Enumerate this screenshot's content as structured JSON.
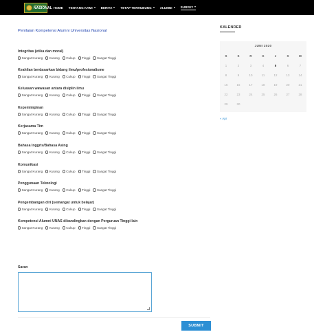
{
  "header": {
    "logo": {
      "small": "UNIVERSITAS",
      "big": "NASIONAL"
    },
    "nav": [
      {
        "label": "HOME",
        "dropdown": false,
        "active": false
      },
      {
        "label": "TENTANG KAMI",
        "dropdown": true,
        "active": false
      },
      {
        "label": "BERITA",
        "dropdown": true,
        "active": false
      },
      {
        "label": "TETAP TERHUBUNG",
        "dropdown": true,
        "active": false
      },
      {
        "label": "ALUMNI",
        "dropdown": true,
        "active": false
      },
      {
        "label": "SURVEY",
        "dropdown": true,
        "active": true
      }
    ]
  },
  "form": {
    "title": "Penilaian Kompetensi Alumni Universitas Nasional",
    "options": [
      "Sangat Kurang",
      "Kurang",
      "Cukup",
      "Tinggi",
      "Sangat Tinggi"
    ],
    "questions": [
      {
        "label": "Integritas (etika dan moral)"
      },
      {
        "label": "Keahlian berdasarkan bidang ilmu/profesionalisme"
      },
      {
        "label": "Keluasan wawasan antara disiplin ilmu"
      },
      {
        "label": "Kepemimpinan"
      },
      {
        "label": "Kerjasama Tim"
      },
      {
        "label": "Bahasa Inggris/Bahasa Asing"
      },
      {
        "label": "Komunikasi"
      },
      {
        "label": "Penggunaan Teknologi"
      },
      {
        "label": "Pengembangan diri (semangat untuk belajar)"
      },
      {
        "label": "Kompetensi Alumni UNAS dibandingkan dengan Perguruan Tinggi lain"
      }
    ],
    "saran_label": "Saran",
    "saran_value": "",
    "submit_label": "SUBMIT"
  },
  "sidebar": {
    "title": "KALENDER",
    "calendar": {
      "caption": "JUNI 2020",
      "weekdays": [
        "S",
        "S",
        "R",
        "K",
        "J",
        "S",
        "M"
      ],
      "weeks": [
        [
          "1",
          "2",
          "3",
          "4",
          "5",
          "6",
          "7"
        ],
        [
          "8",
          "9",
          "10",
          "11",
          "12",
          "13",
          "14"
        ],
        [
          "15",
          "16",
          "17",
          "18",
          "19",
          "20",
          "21"
        ],
        [
          "22",
          "23",
          "24",
          "25",
          "26",
          "27",
          "28"
        ],
        [
          "29",
          "30",
          "",
          "",
          "",
          "",
          ""
        ]
      ],
      "today": "5",
      "prev_link": "« Apr"
    }
  },
  "colors": {
    "nav_bg": "#000000",
    "title_blue": "#2346b0",
    "submit_bg": "#2d8fd4",
    "textarea_border": "#5aa6d6"
  }
}
